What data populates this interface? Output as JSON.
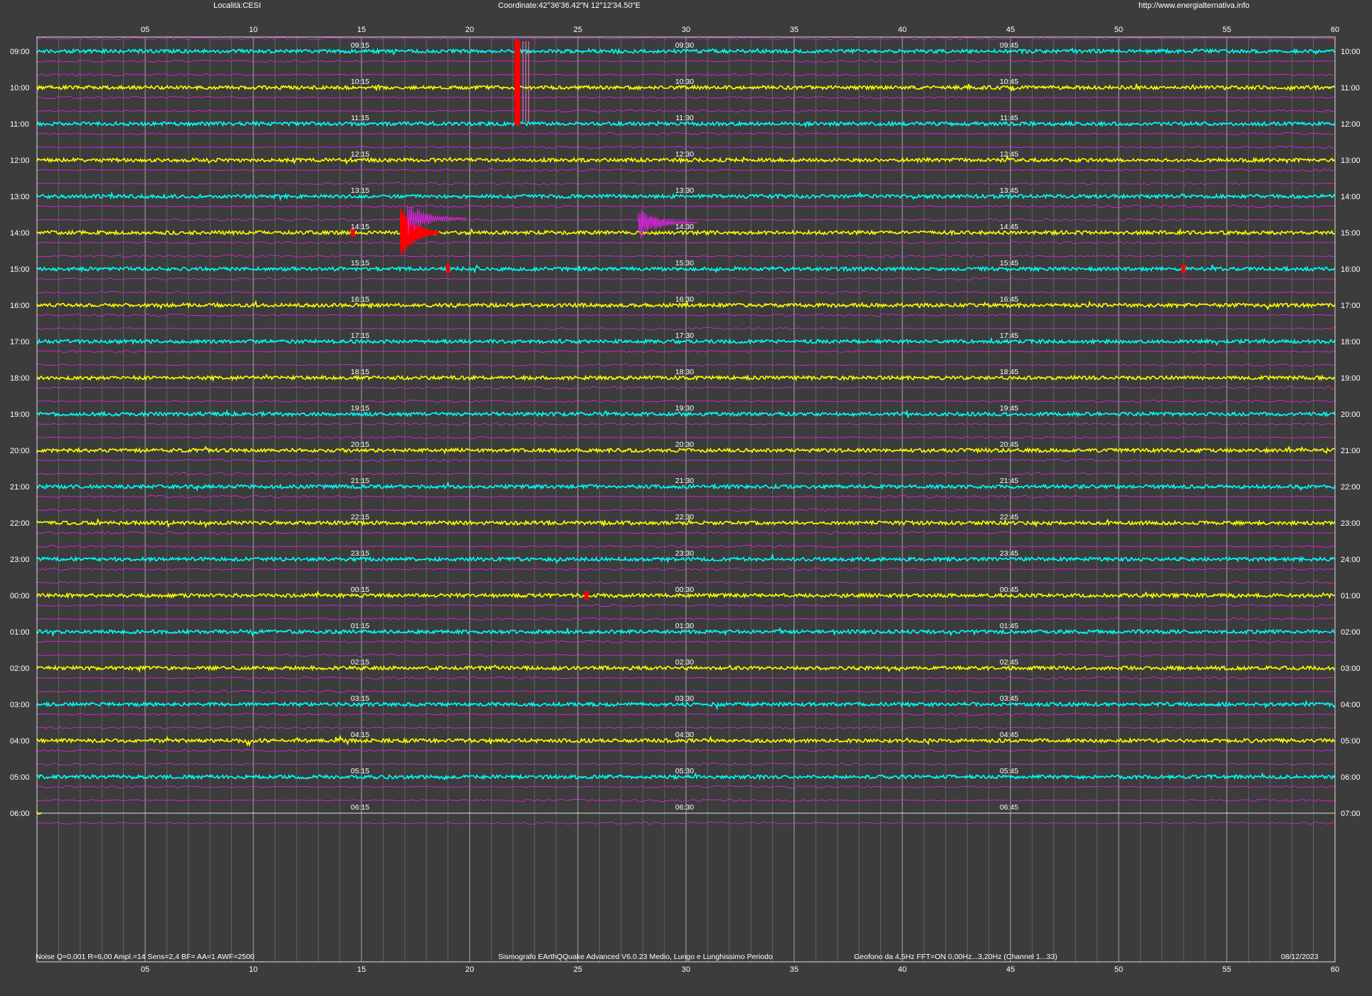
{
  "header": {
    "location": "Località:CESI",
    "coordinates": "Coordinate:42°36'36.42\"N  12°12'34.50\"E",
    "website": "http://www.energialternativa.info"
  },
  "footer": {
    "settings": "Noise Q=0,001 R=6,00 Ampl.=14 Sens=2,4 BF= AA=1 AWF=2500",
    "software": "Sismografo  EArthQQuake Advanced V6.0.23  Medio, Lungo e Lunghissimo Periodo",
    "sensor": "Geofono da 4,5Hz FFT=ON 0,00Hz...3,20Hz      (Channel 1...33)",
    "date": "08/12/2023"
  },
  "chart_data": {
    "type": "line",
    "title": "",
    "xlabel": "",
    "ylabel": "",
    "xlim": [
      0,
      60
    ],
    "x_ticks": [
      "05",
      "10",
      "15",
      "20",
      "25",
      "30",
      "35",
      "40",
      "45",
      "50",
      "55",
      "60"
    ],
    "minute_grid": "every 1 min",
    "left_hour_labels": [
      "09:00",
      "10:00",
      "11:00",
      "12:00",
      "13:00",
      "14:00",
      "15:00",
      "16:00",
      "17:00",
      "18:00",
      "19:00",
      "20:00",
      "21:00",
      "22:00",
      "23:00",
      "00:00",
      "01:00",
      "02:00",
      "03:00",
      "04:00",
      "05:00",
      "06:00"
    ],
    "right_hour_labels": [
      "10:00",
      "11:00",
      "12:00",
      "13:00",
      "14:00",
      "15:00",
      "16:00",
      "17:00",
      "18:00",
      "19:00",
      "20:00",
      "21:00",
      "22:00",
      "23:00",
      "24:00",
      "01:00",
      "02:00",
      "03:00",
      "04:00",
      "05:00",
      "06:00",
      "07:00"
    ],
    "quarter_labels": [
      [
        "09:15",
        "09:30",
        "09:45"
      ],
      [
        "10:15",
        "10:30",
        "10:45"
      ],
      [
        "11:15",
        "11:30",
        "11:45"
      ],
      [
        "12:15",
        "12:30",
        "12:45"
      ],
      [
        "13:15",
        "13:30",
        "13:45"
      ],
      [
        "14:15",
        "14:30",
        "14:45"
      ],
      [
        "15:15",
        "15:30",
        "15:45"
      ],
      [
        "16:15",
        "16:30",
        "16:45"
      ],
      [
        "17:15",
        "17:30",
        "17:45"
      ],
      [
        "18:15",
        "18:30",
        "18:45"
      ],
      [
        "19:15",
        "19:30",
        "19:45"
      ],
      [
        "20:15",
        "20:30",
        "20:45"
      ],
      [
        "21:15",
        "21:30",
        "21:45"
      ],
      [
        "22:15",
        "22:30",
        "22:45"
      ],
      [
        "23:15",
        "23:30",
        "23:45"
      ],
      [
        "00:15",
        "00:30",
        "00:45"
      ],
      [
        "01:15",
        "01:30",
        "01:45"
      ],
      [
        "02:15",
        "02:30",
        "02:45"
      ],
      [
        "03:15",
        "03:30",
        "03:45"
      ],
      [
        "04:15",
        "04:30",
        "04:45"
      ],
      [
        "05:15",
        "05:30",
        "05:45"
      ],
      [
        "06:15",
        "06:30",
        "06:45"
      ]
    ],
    "series_colors": {
      "trace_a": "#00ffff",
      "trace_b": "#ffff00",
      "long_period": "#e020e0",
      "event": "#ff0000"
    },
    "events": [
      {
        "row": 0,
        "minute": 22.2,
        "note": "red bar spanning rows 0-2"
      },
      {
        "row": 5,
        "minute": 14.6
      },
      {
        "row": 5,
        "minute": 16.8,
        "note": "large red burst"
      },
      {
        "row": 6,
        "minute": 19.0
      },
      {
        "row": 6,
        "minute": 53.0
      },
      {
        "row": 15,
        "minute": 25.4
      }
    ],
    "last_row_minutes": 0.2
  }
}
